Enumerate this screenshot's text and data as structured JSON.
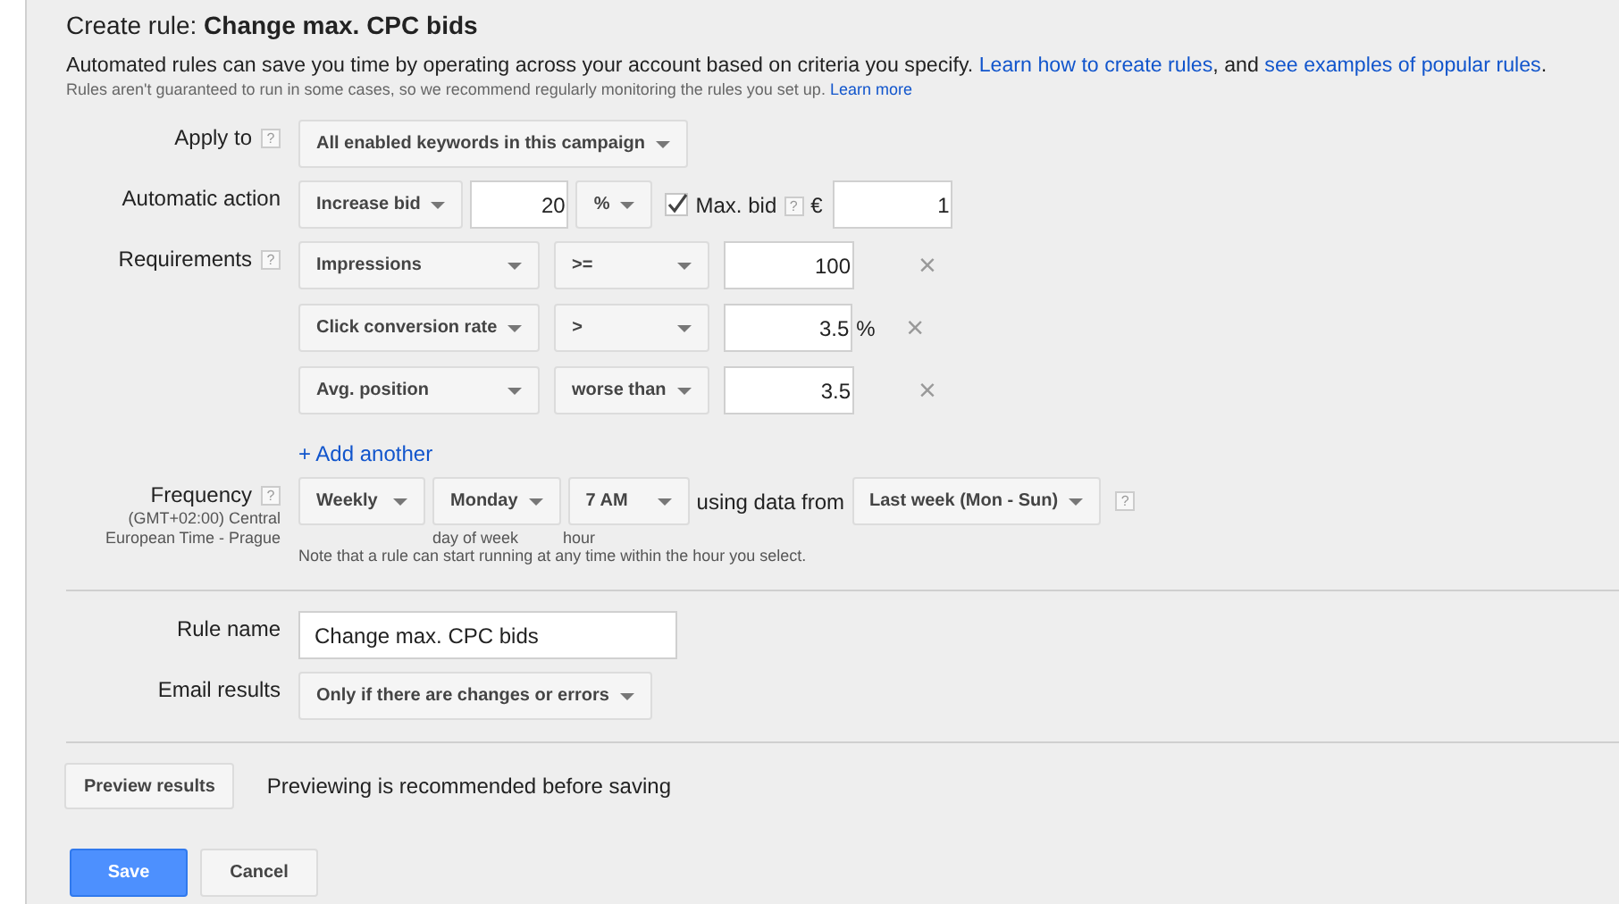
{
  "title": {
    "prefix": "Create rule:",
    "name": "Change max. CPC bids"
  },
  "intro": [
    {
      "kind": "text",
      "text": "Automated rules can save you time by operating across your account based on criteria you specify. "
    },
    {
      "kind": "link",
      "text": "Learn how to create rules"
    },
    {
      "kind": "text",
      "text": ", and "
    },
    {
      "kind": "link",
      "text": "see examples of popular rules"
    },
    {
      "kind": "text",
      "text": "."
    }
  ],
  "note": [
    {
      "kind": "text",
      "text": "Rules aren't guaranteed to run in some cases, so we recommend regularly monitoring the rules you set up. "
    },
    {
      "kind": "link",
      "text": "Learn more"
    }
  ],
  "apply_to": {
    "label": "Apply to",
    "help": "?",
    "value": "All enabled keywords in this campaign"
  },
  "automatic_action": {
    "label": "Automatic action",
    "action": "Increase bid",
    "amount": "20",
    "unit": "%",
    "max_bid": {
      "checked": true,
      "label": "Max. bid",
      "help": "?",
      "currency": "€",
      "value": "1"
    }
  },
  "requirements": {
    "label": "Requirements",
    "help": "?",
    "rows": [
      {
        "metric": "Impressions",
        "operator": ">=",
        "value": "100",
        "remove": "×"
      },
      {
        "metric": "Click conversion rate",
        "operator": ">",
        "value": "3.5",
        "unit": "%",
        "remove": "×"
      },
      {
        "metric": "Avg. position",
        "operator": "worse than",
        "value": "3.5",
        "remove": "×"
      }
    ],
    "add": "+ Add another"
  },
  "frequency": {
    "label": "Frequency",
    "help": "?",
    "timezone": "(GMT+02:00) Central European Time - Prague",
    "period": "Weekly",
    "day": "Monday",
    "day_caption": "day of week",
    "hour": "7 AM",
    "hour_caption": "hour",
    "using": "using data from",
    "range": "Last week (Mon - Sun)",
    "range_help": "?",
    "note": "Note that a rule can start running at any time within the hour you select."
  },
  "rule_name": {
    "label": "Rule name",
    "value": "Change max. CPC bids"
  },
  "email_results": {
    "label": "Email results",
    "value": "Only if there are changes or errors"
  },
  "preview": {
    "button": "Preview results",
    "hint": "Previewing is recommended before saving"
  },
  "buttons": [
    {
      "kind": "primary",
      "label": "Save"
    },
    {
      "kind": "default",
      "label": "Cancel"
    }
  ]
}
